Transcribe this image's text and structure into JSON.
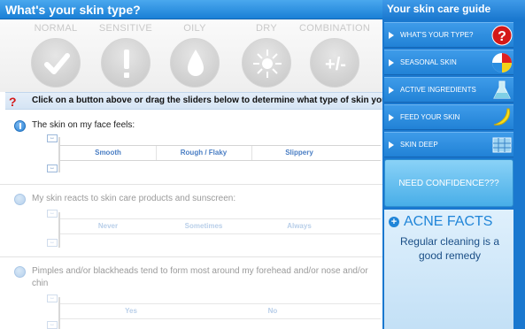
{
  "main": {
    "title": "What's your skin type?",
    "skin_types": [
      {
        "label": "NORMAL",
        "icon": "checkmark-icon"
      },
      {
        "label": "SENSITIVE",
        "icon": "exclamation-icon"
      },
      {
        "label": "OILY",
        "icon": "droplet-icon"
      },
      {
        "label": "DRY",
        "icon": "sun-icon"
      },
      {
        "label": "COMBINATION",
        "icon": "plus-minus-icon"
      }
    ],
    "help_text": "Click on a button above or drag the sliders below to determine what type of skin you have.",
    "questions": [
      {
        "text": "The skin on my face feels:",
        "options": [
          "Smooth",
          "Rough / Flaky",
          "Slippery"
        ],
        "active": true
      },
      {
        "text": "My skin reacts to skin care products and sunscreen:",
        "options": [
          "Never",
          "Sometimes",
          "Always"
        ],
        "active": false
      },
      {
        "text": "Pimples and/or blackheads tend to form most around my forehead and/or nose and/or chin",
        "options": [
          "Yes",
          "No"
        ],
        "active": false
      }
    ]
  },
  "guide": {
    "title": "Your skin care guide",
    "items": [
      {
        "label": "WHAT'S YOUR TYPE?",
        "icon": "question-mark-icon"
      },
      {
        "label": "SEASONAL SKIN",
        "icon": "beach-ball-icon"
      },
      {
        "label": "ACTIVE INGREDIENTS",
        "icon": "flask-icon"
      },
      {
        "label": "FEED YOUR SKIN",
        "icon": "banana-icon"
      },
      {
        "label": "SKIN DEEP",
        "icon": "skin-cells-icon"
      }
    ],
    "confidence_label": "NEED CONFIDENCE???",
    "acne_heading": "ACNE FACTS",
    "acne_body": "Regular cleaning is a good remedy"
  },
  "colors": {
    "header_blue": "#1a7fd6",
    "guide_blue": "#1a78cf",
    "link_blue": "#4a7ec4",
    "acne_text": "#1a4e86"
  }
}
